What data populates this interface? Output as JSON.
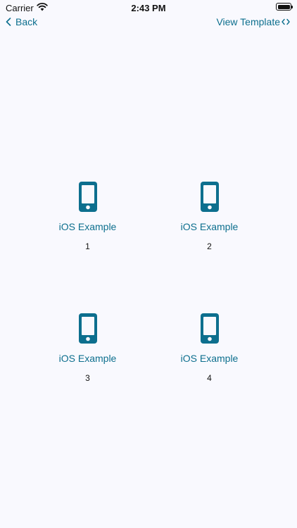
{
  "status_bar": {
    "carrier": "Carrier",
    "time": "2:43 PM"
  },
  "nav": {
    "back_label": "Back",
    "view_template_label": "View Template"
  },
  "colors": {
    "accent": "#0d6f8e",
    "background": "#f9f9fe"
  },
  "items": [
    {
      "title": "iOS Example",
      "number": "1",
      "icon": "phone-icon"
    },
    {
      "title": "iOS Example",
      "number": "2",
      "icon": "phone-icon"
    },
    {
      "title": "iOS Example",
      "number": "3",
      "icon": "phone-icon"
    },
    {
      "title": "iOS Example",
      "number": "4",
      "icon": "phone-icon"
    }
  ]
}
